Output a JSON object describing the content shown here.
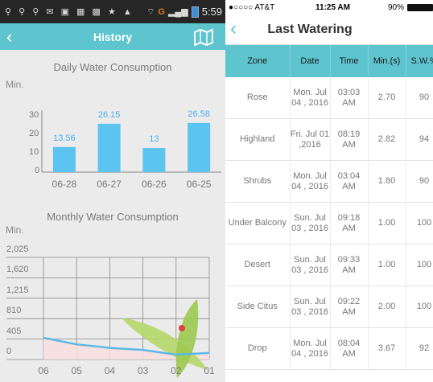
{
  "android": {
    "status_time": "5:59",
    "network": "G",
    "header_title": "History",
    "daily": {
      "title": "Daily Water Consumption",
      "unit": "Min.",
      "yticks": [
        "0",
        "10",
        "20",
        "30"
      ],
      "categories": [
        "06-28",
        "06-27",
        "06-26",
        "06-25"
      ],
      "labels": [
        "13.56",
        "26.15",
        "13",
        "26.58"
      ]
    },
    "monthly": {
      "title": "Monthly Water Consumption",
      "unit": "Min.",
      "yticks": [
        "0",
        "405",
        "810",
        "1,215",
        "1,620",
        "2,025"
      ],
      "categories": [
        "06",
        "05",
        "04",
        "03",
        "02",
        "01"
      ]
    }
  },
  "ios": {
    "carrier": "●○○○○ AT&T",
    "time": "11:25 AM",
    "battery": "90%",
    "nav_title": "Last Watering",
    "columns": [
      "Zone",
      "Date",
      "Time",
      "Min.(s)",
      "S.W.%"
    ],
    "rows": [
      [
        "Rose",
        "Mon. Jul 04 , 2016",
        "03:03 AM",
        "2.70",
        "90"
      ],
      [
        "Highland",
        "Fri. Jul 01 ,2016",
        "08:19 AM",
        "2.82",
        "94"
      ],
      [
        "Shrubs",
        "Mon. Jul 04 , 2016",
        "03:04 AM",
        "1.80",
        "90"
      ],
      [
        "Under Balcony",
        "Sun. Jul 03 , 2016",
        "09:18 AM",
        "1.00",
        "100"
      ],
      [
        "Desert",
        "Sun. Jul 03 , 2016",
        "09:33 AM",
        "1.00",
        "100"
      ],
      [
        "Side Citus",
        "Sun. Jul 03 , 2016",
        "09:22 AM",
        "2.00",
        "100"
      ],
      [
        "Drop",
        "Mon. Jul 04 , 2016",
        "08:04 AM",
        "3.67",
        "92"
      ]
    ]
  },
  "chart_data": [
    {
      "type": "bar",
      "title": "Daily Water Consumption",
      "ylabel": "Min.",
      "categories": [
        "06-28",
        "06-27",
        "06-26",
        "06-25"
      ],
      "values": [
        13.56,
        26.15,
        13,
        26.58
      ],
      "ylim": [
        0,
        30
      ],
      "color": "#5cc4f0"
    },
    {
      "type": "area",
      "title": "Monthly Water Consumption",
      "ylabel": "Min.",
      "categories": [
        "06",
        "05",
        "04",
        "03",
        "02",
        "01"
      ],
      "values": [
        430,
        300,
        230,
        190,
        95,
        130
      ],
      "ylim": [
        0,
        2025
      ],
      "color": "#5cb8e6",
      "fill": "#f9dede"
    }
  ]
}
